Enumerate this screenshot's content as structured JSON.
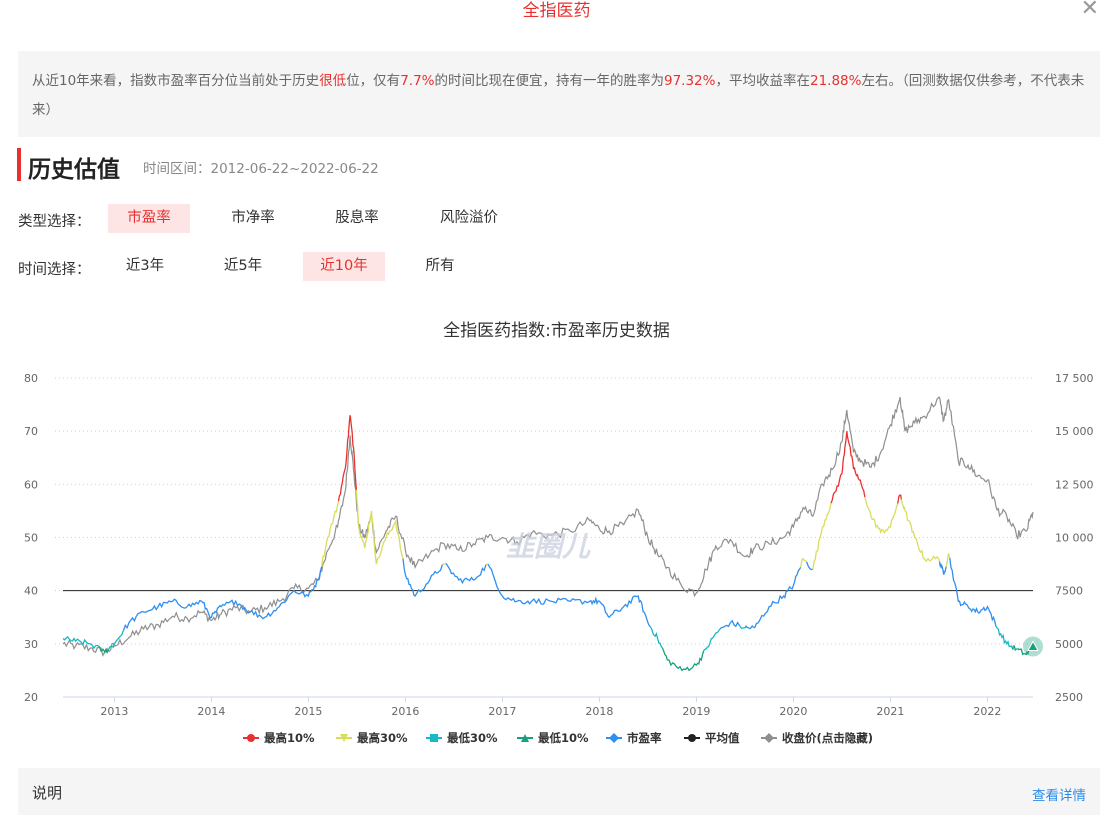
{
  "header": {
    "title": "全指医药",
    "close_icon": "close-icon"
  },
  "summary": {
    "p1": "从近10年来看，指数市盈率百分位当前处于历史",
    "h1": "很低",
    "p2": "位，仅有",
    "h2": "7.7%",
    "p3": "的时间比现在便宜，持有一年的胜率为",
    "h3": "97.32%",
    "p4": "，平均收益率在",
    "h4": "21.88%",
    "p5": "左右。（回测数据仅供参考，不代表未来）"
  },
  "section": {
    "title": "历史估值",
    "range": "时间区间：2012-06-22~2022-06-22"
  },
  "type_select": {
    "label": "类型选择：",
    "options": [
      "市盈率",
      "市净率",
      "股息率",
      "风险溢价"
    ],
    "selected": 0
  },
  "time_select": {
    "label": "时间选择：",
    "options": [
      "近3年",
      "近5年",
      "近10年",
      "所有"
    ],
    "selected": 2
  },
  "chart_data": {
    "type": "line",
    "title": "全指医药指数:市盈率历史数据",
    "x_ticks": [
      "2013",
      "2014",
      "2015",
      "2016",
      "2017",
      "2018",
      "2019",
      "2020",
      "2021",
      "2022"
    ],
    "x_range": [
      2012.47,
      2022.47
    ],
    "y_left": {
      "min": 20,
      "max": 80,
      "ticks": [
        20,
        30,
        40,
        50,
        60,
        70,
        80
      ]
    },
    "y_right": {
      "min": 2500,
      "max": 17500,
      "ticks": [
        "2500",
        "5000",
        "7500",
        "10 000",
        "12 500",
        "15 000",
        "17 500"
      ]
    },
    "average_pe": 40,
    "thresholds": {
      "top10": 57,
      "top30": 45,
      "low30": 33,
      "low10": 29
    },
    "pe_series": {
      "name": "市盈率",
      "points": [
        [
          2012.47,
          31
        ],
        [
          2012.6,
          30.5
        ],
        [
          2012.75,
          30
        ],
        [
          2012.9,
          28.5
        ],
        [
          2013.0,
          30
        ],
        [
          2013.15,
          34
        ],
        [
          2013.3,
          36
        ],
        [
          2013.45,
          37
        ],
        [
          2013.6,
          38
        ],
        [
          2013.75,
          37
        ],
        [
          2013.9,
          38
        ],
        [
          2014.0,
          35
        ],
        [
          2014.1,
          37
        ],
        [
          2014.25,
          38
        ],
        [
          2014.4,
          36
        ],
        [
          2014.55,
          35
        ],
        [
          2014.7,
          37
        ],
        [
          2014.85,
          40
        ],
        [
          2015.0,
          39
        ],
        [
          2015.1,
          42
        ],
        [
          2015.2,
          50
        ],
        [
          2015.3,
          56
        ],
        [
          2015.38,
          63
        ],
        [
          2015.43,
          73
        ],
        [
          2015.47,
          66
        ],
        [
          2015.52,
          52
        ],
        [
          2015.58,
          48
        ],
        [
          2015.65,
          55
        ],
        [
          2015.7,
          45
        ],
        [
          2015.8,
          50
        ],
        [
          2015.9,
          53
        ],
        [
          2016.0,
          43
        ],
        [
          2016.1,
          39
        ],
        [
          2016.25,
          42
        ],
        [
          2016.4,
          45
        ],
        [
          2016.55,
          42
        ],
        [
          2016.7,
          42
        ],
        [
          2016.85,
          45
        ],
        [
          2017.0,
          39
        ],
        [
          2017.15,
          38
        ],
        [
          2017.3,
          38
        ],
        [
          2017.5,
          38
        ],
        [
          2017.7,
          38
        ],
        [
          2017.9,
          38
        ],
        [
          2018.0,
          38
        ],
        [
          2018.1,
          35
        ],
        [
          2018.25,
          37
        ],
        [
          2018.4,
          39
        ],
        [
          2018.5,
          34
        ],
        [
          2018.6,
          31
        ],
        [
          2018.7,
          27
        ],
        [
          2018.85,
          25
        ],
        [
          2019.0,
          26
        ],
        [
          2019.1,
          29
        ],
        [
          2019.2,
          32
        ],
        [
          2019.35,
          34
        ],
        [
          2019.5,
          33
        ],
        [
          2019.6,
          33
        ],
        [
          2019.75,
          37
        ],
        [
          2019.9,
          39
        ],
        [
          2020.0,
          41
        ],
        [
          2020.1,
          46
        ],
        [
          2020.2,
          44
        ],
        [
          2020.3,
          52
        ],
        [
          2020.4,
          57
        ],
        [
          2020.5,
          62
        ],
        [
          2020.55,
          70
        ],
        [
          2020.62,
          63
        ],
        [
          2020.7,
          60
        ],
        [
          2020.8,
          54
        ],
        [
          2020.9,
          51
        ],
        [
          2021.0,
          52
        ],
        [
          2021.1,
          58
        ],
        [
          2021.15,
          55
        ],
        [
          2021.25,
          50
        ],
        [
          2021.35,
          46
        ],
        [
          2021.5,
          46
        ],
        [
          2021.55,
          43
        ],
        [
          2021.6,
          47
        ],
        [
          2021.7,
          38
        ],
        [
          2021.8,
          37
        ],
        [
          2021.9,
          36
        ],
        [
          2022.0,
          37
        ],
        [
          2022.1,
          33
        ],
        [
          2022.2,
          30
        ],
        [
          2022.3,
          29
        ],
        [
          2022.4,
          28
        ],
        [
          2022.47,
          29.5
        ]
      ]
    },
    "close_series": {
      "name": "收盘价(点击隐藏)",
      "points": [
        [
          2012.47,
          5000
        ],
        [
          2012.6,
          4900
        ],
        [
          2012.75,
          4800
        ],
        [
          2012.9,
          4600
        ],
        [
          2013.0,
          4900
        ],
        [
          2013.15,
          5300
        ],
        [
          2013.3,
          5700
        ],
        [
          2013.45,
          5900
        ],
        [
          2013.6,
          6300
        ],
        [
          2013.75,
          6200
        ],
        [
          2013.9,
          6500
        ],
        [
          2014.0,
          6100
        ],
        [
          2014.1,
          6400
        ],
        [
          2014.25,
          6700
        ],
        [
          2014.4,
          6500
        ],
        [
          2014.55,
          6700
        ],
        [
          2014.7,
          7000
        ],
        [
          2014.85,
          7600
        ],
        [
          2015.0,
          7600
        ],
        [
          2015.1,
          8000
        ],
        [
          2015.2,
          9400
        ],
        [
          2015.3,
          10500
        ],
        [
          2015.38,
          12200
        ],
        [
          2015.43,
          14800
        ],
        [
          2015.47,
          13000
        ],
        [
          2015.52,
          10500
        ],
        [
          2015.58,
          10000
        ],
        [
          2015.65,
          11000
        ],
        [
          2015.7,
          9300
        ],
        [
          2015.8,
          10300
        ],
        [
          2015.9,
          11000
        ],
        [
          2016.0,
          9400
        ],
        [
          2016.1,
          8600
        ],
        [
          2016.25,
          9200
        ],
        [
          2016.4,
          9700
        ],
        [
          2016.55,
          9400
        ],
        [
          2016.7,
          9700
        ],
        [
          2016.85,
          10000
        ],
        [
          2017.0,
          10000
        ],
        [
          2017.15,
          9800
        ],
        [
          2017.3,
          10200
        ],
        [
          2017.5,
          10100
        ],
        [
          2017.7,
          10300
        ],
        [
          2017.9,
          10800
        ],
        [
          2018.0,
          10400
        ],
        [
          2018.1,
          10300
        ],
        [
          2018.25,
          10600
        ],
        [
          2018.4,
          11300
        ],
        [
          2018.5,
          10000
        ],
        [
          2018.6,
          9200
        ],
        [
          2018.7,
          8600
        ],
        [
          2018.85,
          7700
        ],
        [
          2019.0,
          7400
        ],
        [
          2019.1,
          8500
        ],
        [
          2019.2,
          9600
        ],
        [
          2019.35,
          9900
        ],
        [
          2019.5,
          9100
        ],
        [
          2019.6,
          9500
        ],
        [
          2019.75,
          9700
        ],
        [
          2019.9,
          10000
        ],
        [
          2020.0,
          10500
        ],
        [
          2020.1,
          11400
        ],
        [
          2020.2,
          11000
        ],
        [
          2020.3,
          12500
        ],
        [
          2020.4,
          13200
        ],
        [
          2020.5,
          14500
        ],
        [
          2020.55,
          16000
        ],
        [
          2020.62,
          14000
        ],
        [
          2020.7,
          13600
        ],
        [
          2020.8,
          13300
        ],
        [
          2020.9,
          14000
        ],
        [
          2021.0,
          15300
        ],
        [
          2021.1,
          16600
        ],
        [
          2021.15,
          15000
        ],
        [
          2021.25,
          15400
        ],
        [
          2021.35,
          15700
        ],
        [
          2021.5,
          16600
        ],
        [
          2021.55,
          15500
        ],
        [
          2021.6,
          16500
        ],
        [
          2021.7,
          13600
        ],
        [
          2021.8,
          13400
        ],
        [
          2021.9,
          12900
        ],
        [
          2022.0,
          12700
        ],
        [
          2022.1,
          11300
        ],
        [
          2022.2,
          11000
        ],
        [
          2022.3,
          10100
        ],
        [
          2022.4,
          10300
        ],
        [
          2022.47,
          11200
        ]
      ]
    },
    "legend": [
      "最高10%",
      "最高30%",
      "最低30%",
      "最低10%",
      "市盈率",
      "平均值",
      "收盘价(点击隐藏)"
    ],
    "colors": {
      "top10": "#e8312f",
      "top30": "#d9dd5c",
      "low30": "#19b8c4",
      "low10": "#14a17c",
      "pe": "#2f8ff0",
      "avg": "#222222",
      "close": "#8f8f8f",
      "grid": "#d0d0d0",
      "axis_text": "#666666"
    },
    "legend_position": "bottom",
    "grid": true
  },
  "footer": {
    "label": "说明",
    "more": "查看详情"
  }
}
